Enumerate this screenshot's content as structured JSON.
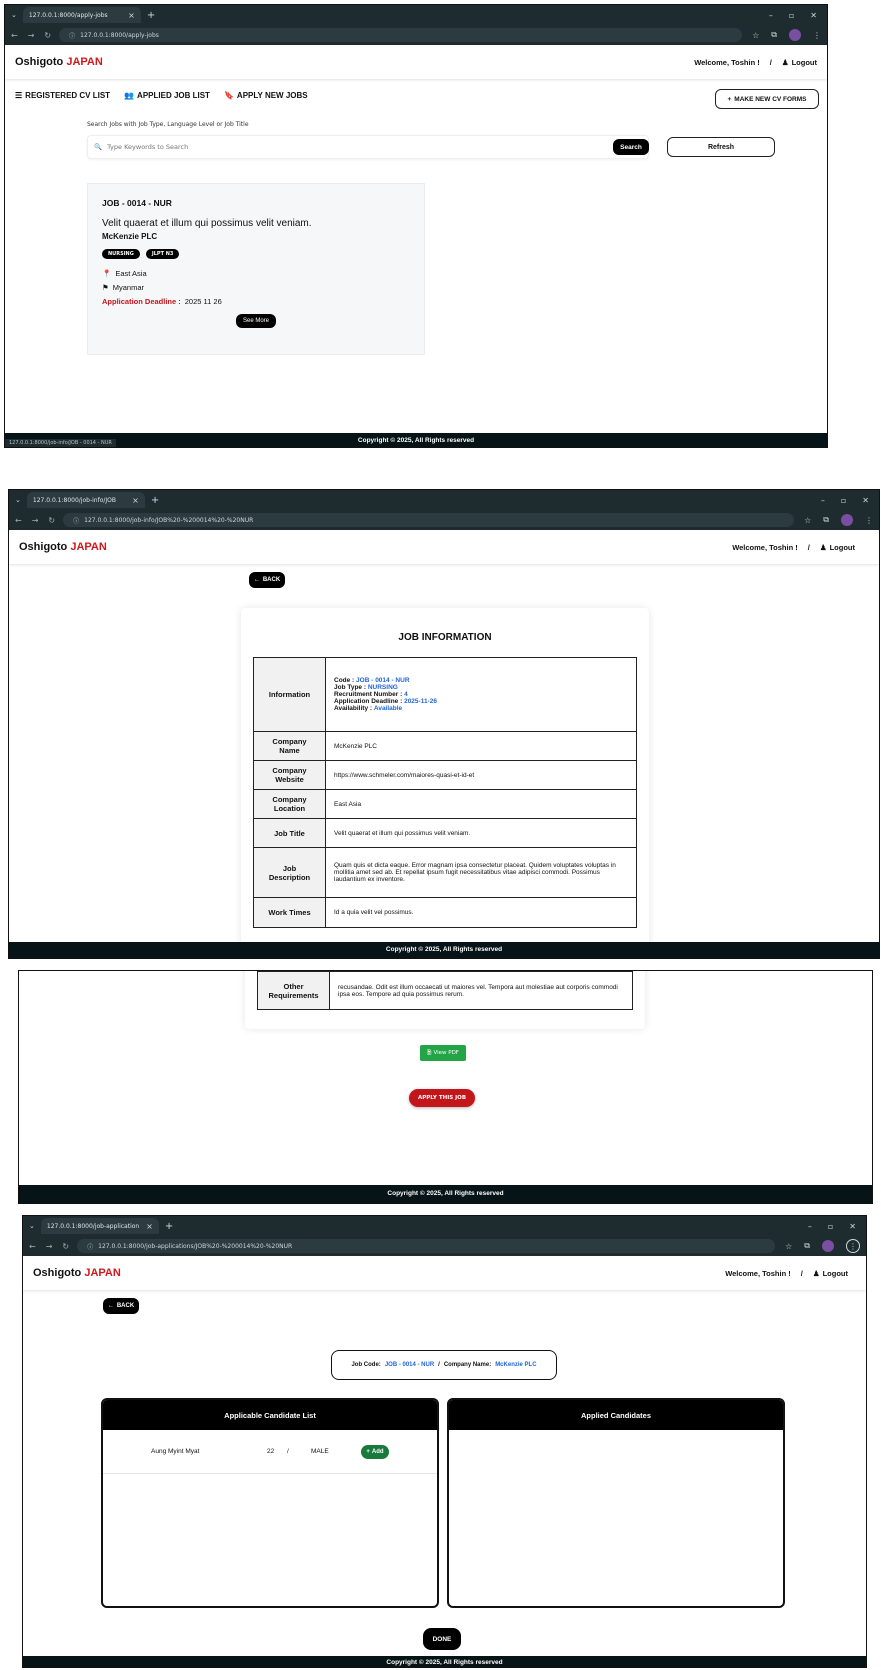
{
  "common": {
    "brand_main": "Oshigoto",
    "brand_accent": "JAPAN",
    "welcome": "Welcome, Toshin !",
    "separator": "/",
    "logout": "Logout",
    "copyright": "Copyright © 2025, All Rights reserved",
    "back": "BACK",
    "accent_color": "#d0181c",
    "link_color": "#1e64d8"
  },
  "shot1": {
    "tab_title": "127.0.0.1:8000/apply-jobs",
    "url": "127.0.0.1:8000/apply-jobs",
    "nav": {
      "registered_cv": "REGISTERED CV LIST",
      "applied_job": "APPLIED JOB LIST",
      "apply_new": "APPLY NEW JOBS",
      "make_cv": "MAKE NEW CV FORMS"
    },
    "search_hint": "Search Jobs with Job Type, Language Level or Job Title",
    "search_placeholder": "Type Keywords to Search",
    "search_button": "Search",
    "refresh_button": "Refresh",
    "job": {
      "code": "JOB - 0014 - NUR",
      "title": "Velit quaerat et illum qui possimus velit veniam.",
      "company": "McKenzie PLC",
      "tags": [
        "NURSING",
        "JLPT N3"
      ],
      "region": "East Asia",
      "country": "Myanmar",
      "deadline_label": "Application Deadline :",
      "deadline": "2025 11 26",
      "see_more": "See More"
    },
    "status_url": "127.0.0.1:8000/job-info/JOB - 0014 - NUR"
  },
  "shot2": {
    "tab_title": "127.0.0.1:8000/job-info/JOB",
    "url": "127.0.0.1:8000/job-info/JOB%20-%200014%20-%20NUR",
    "heading": "JOB INFORMATION",
    "info": {
      "label": "Information",
      "code_label": "Code :",
      "code": "JOB - 0014 - NUR",
      "type_label": "Job Type :",
      "type": "NURSING",
      "recruit_label": "Recruitment Number :",
      "recruit": "4",
      "deadline_label": "Application Deadline :",
      "deadline": "2025-11-26",
      "avail_label": "Availability :",
      "avail": "Available"
    },
    "rows": [
      {
        "k": "Company Name",
        "v": "McKenzie PLC"
      },
      {
        "k": "Company Website",
        "v": "https://www.schmeler.com/maiores-quasi-et-id-et"
      },
      {
        "k": "Company Location",
        "v": "East Asia"
      },
      {
        "k": "Job Title",
        "v": "Velit quaerat et illum qui possimus velit veniam."
      },
      {
        "k": "Job Description",
        "v": "Quam quis et dicta eaque. Error magnam ipsa consectetur placeat. Quidem voluptates voluptas in mollitia amet sed ab. Et repellat ipsum fugit necessitatibus vitae adipisci commodi. Possimus laudantium ex inventore."
      },
      {
        "k": "Work Times",
        "v": "Id a quia velit vel possimus."
      }
    ]
  },
  "shot3": {
    "other_label": "Other Requirements",
    "other_value": "recusandae. Odit est illum occaecati ut maiores vel. Tempora aut molestiae aut corporis commodi ipsa eos. Tempore ad quia possimus rerum.",
    "view_pdf": "View PDF",
    "apply": "APPLY THIS JOB"
  },
  "shot4": {
    "tab_title": "127.0.0.1:8000/job-application",
    "url": "127.0.0.1:8000/job-applications/JOB%20-%200014%20-%20NUR",
    "job_code_label": "Job Code:",
    "job_code": "JOB - 0014 - NUR",
    "company_label": "Company Name:",
    "company": "McKenzie PLC",
    "applicable_title": "Applicable Candidate List",
    "applied_title": "Applied Candidates",
    "candidates": [
      {
        "name": "Aung Myint Myat",
        "age": "22",
        "gender": "MALE",
        "add": "Add"
      }
    ],
    "done": "DONE"
  }
}
